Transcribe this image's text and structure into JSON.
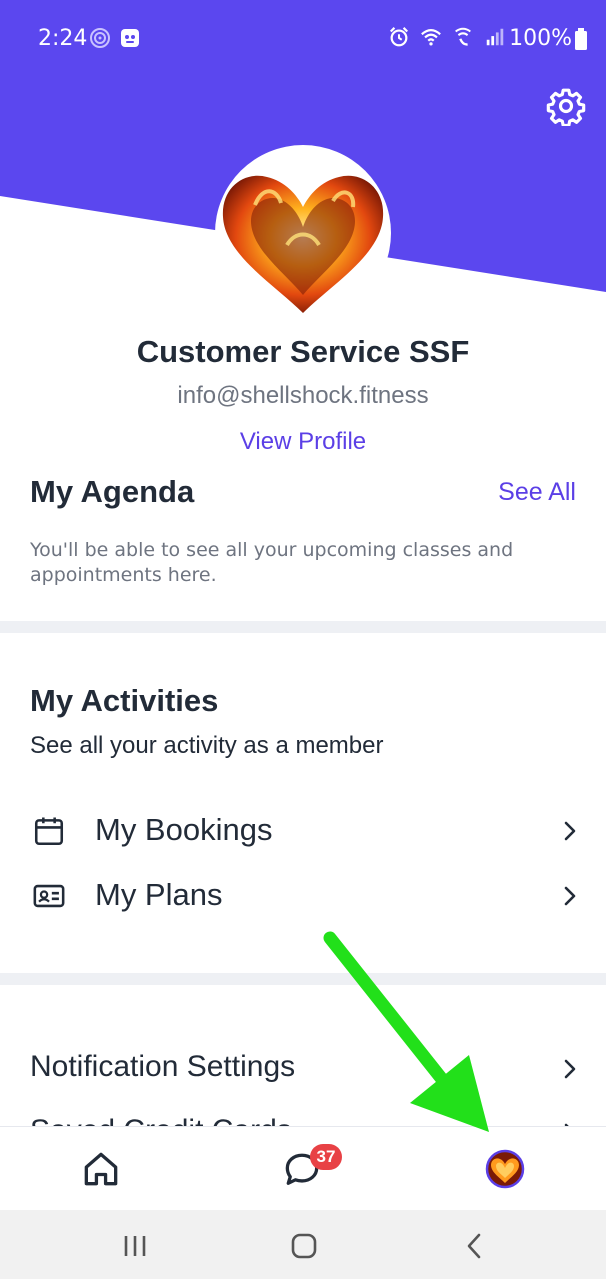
{
  "status_bar": {
    "time": "2:24",
    "battery": "100%"
  },
  "header": {
    "settings_icon": "gear-icon",
    "brand_color": "#5b47ef"
  },
  "profile": {
    "name": "Customer Service SSF",
    "email": "info@shellshock.fitness",
    "view_profile_label": "View Profile",
    "avatar": "fiery-heart-avatar"
  },
  "agenda": {
    "title": "My Agenda",
    "see_all_label": "See All",
    "empty_text": "You'll be able to see all your upcoming classes and appointments here."
  },
  "activities": {
    "title": "My Activities",
    "subtitle": "See all your activity as a member",
    "items": [
      {
        "label": "My Bookings",
        "icon": "calendar-icon"
      },
      {
        "label": "My Plans",
        "icon": "id-card-icon"
      }
    ]
  },
  "settings_list": {
    "items": [
      {
        "label": "Notification Settings"
      },
      {
        "label": "Saved Credit Cards"
      }
    ]
  },
  "bottom_nav": {
    "items": [
      {
        "name": "home",
        "icon": "home-icon"
      },
      {
        "name": "messages",
        "icon": "chat-bubble-icon",
        "badge": "37"
      },
      {
        "name": "profile",
        "icon": "avatar-icon"
      }
    ]
  },
  "annotation": {
    "type": "green-arrow",
    "color": "#22e01a",
    "points_to": "profile tab"
  },
  "colors": {
    "accent": "#5b3fe6",
    "badge": "#e84145",
    "text_dark": "#222b38",
    "text_muted": "#6e7480"
  }
}
